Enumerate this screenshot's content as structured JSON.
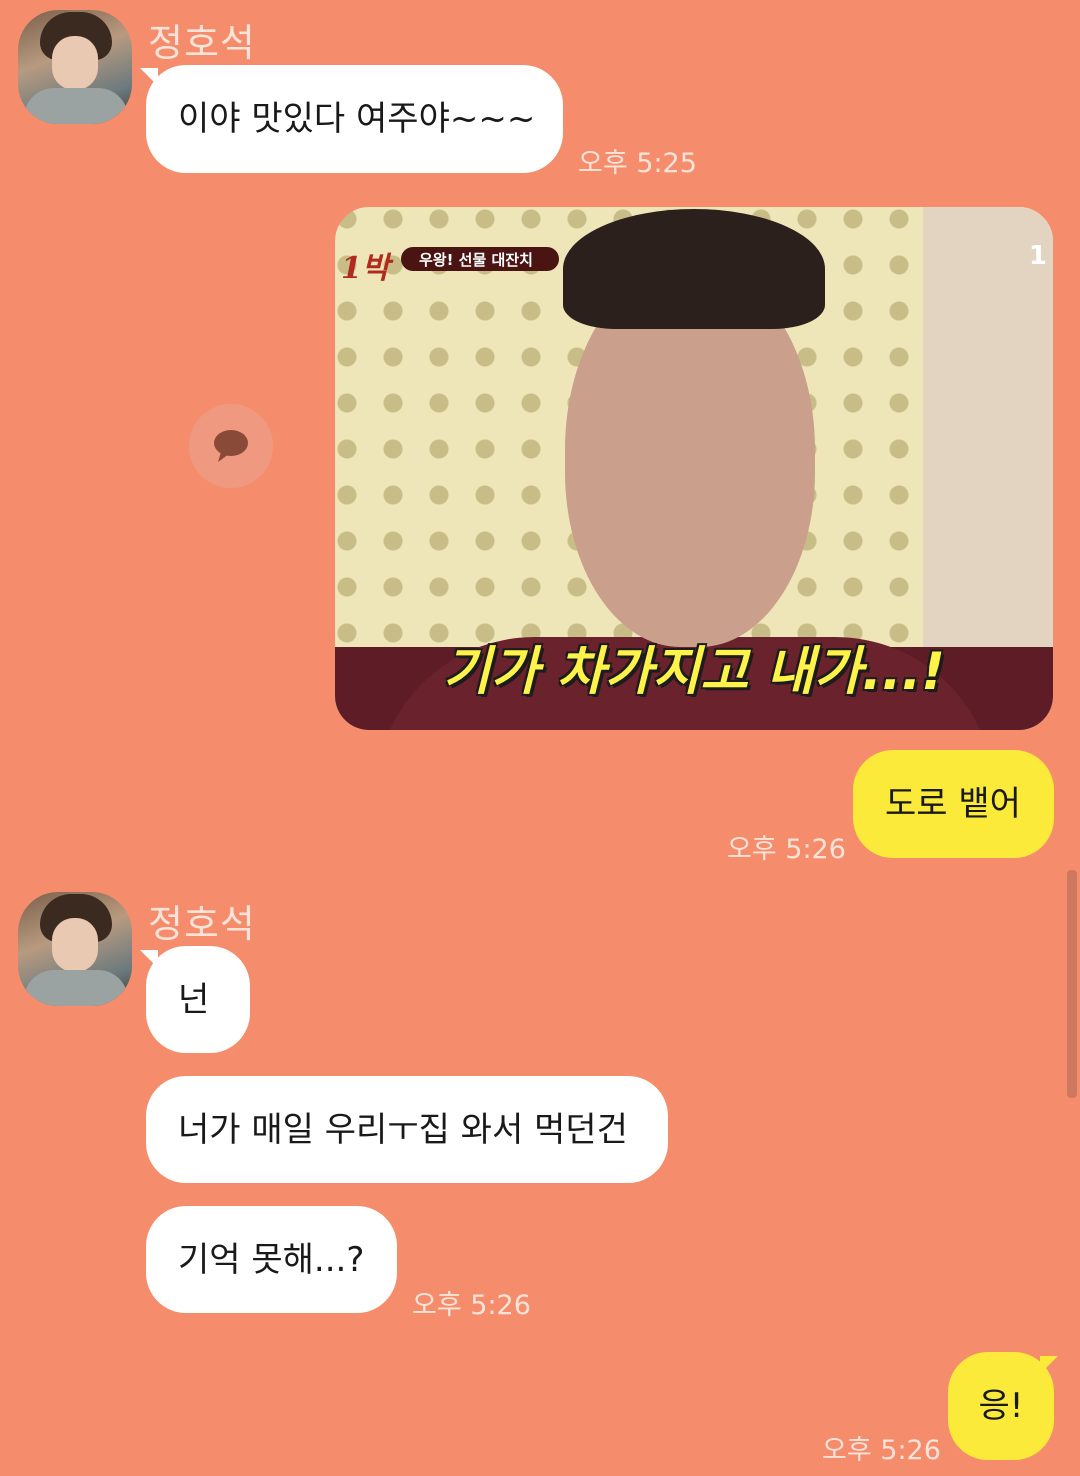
{
  "chat": {
    "groups": [
      {
        "sender": "정호석",
        "messages": [
          "이야 맛있다 여주야~~~"
        ],
        "time": "오후 5:25"
      },
      {
        "sender": "정호석",
        "messages": [
          "넌",
          "너가 매일 우리ㅜ집 와서 먹던건",
          "기억 못해...?"
        ],
        "time": "오후 5:26"
      }
    ],
    "outgoing": [
      {
        "type": "image",
        "image": {
          "logo_text": "1박",
          "banner_text": "우왕! 선물 대잔치",
          "channel_text": "1",
          "caption": "기가 차가지고 내가...!"
        }
      },
      {
        "type": "text",
        "text": "도로 뱉어",
        "time": "오후 5:26"
      },
      {
        "type": "text",
        "text": "응!",
        "time": "오후 5:26"
      }
    ]
  },
  "icons": {
    "reply": "speech-bubble-icon",
    "avatar": "profile-photo"
  },
  "colors": {
    "background": "#f58d6d",
    "incoming_bubble": "#ffffff",
    "outgoing_bubble": "#fcea3b",
    "meta_text": "#fde3d8"
  }
}
